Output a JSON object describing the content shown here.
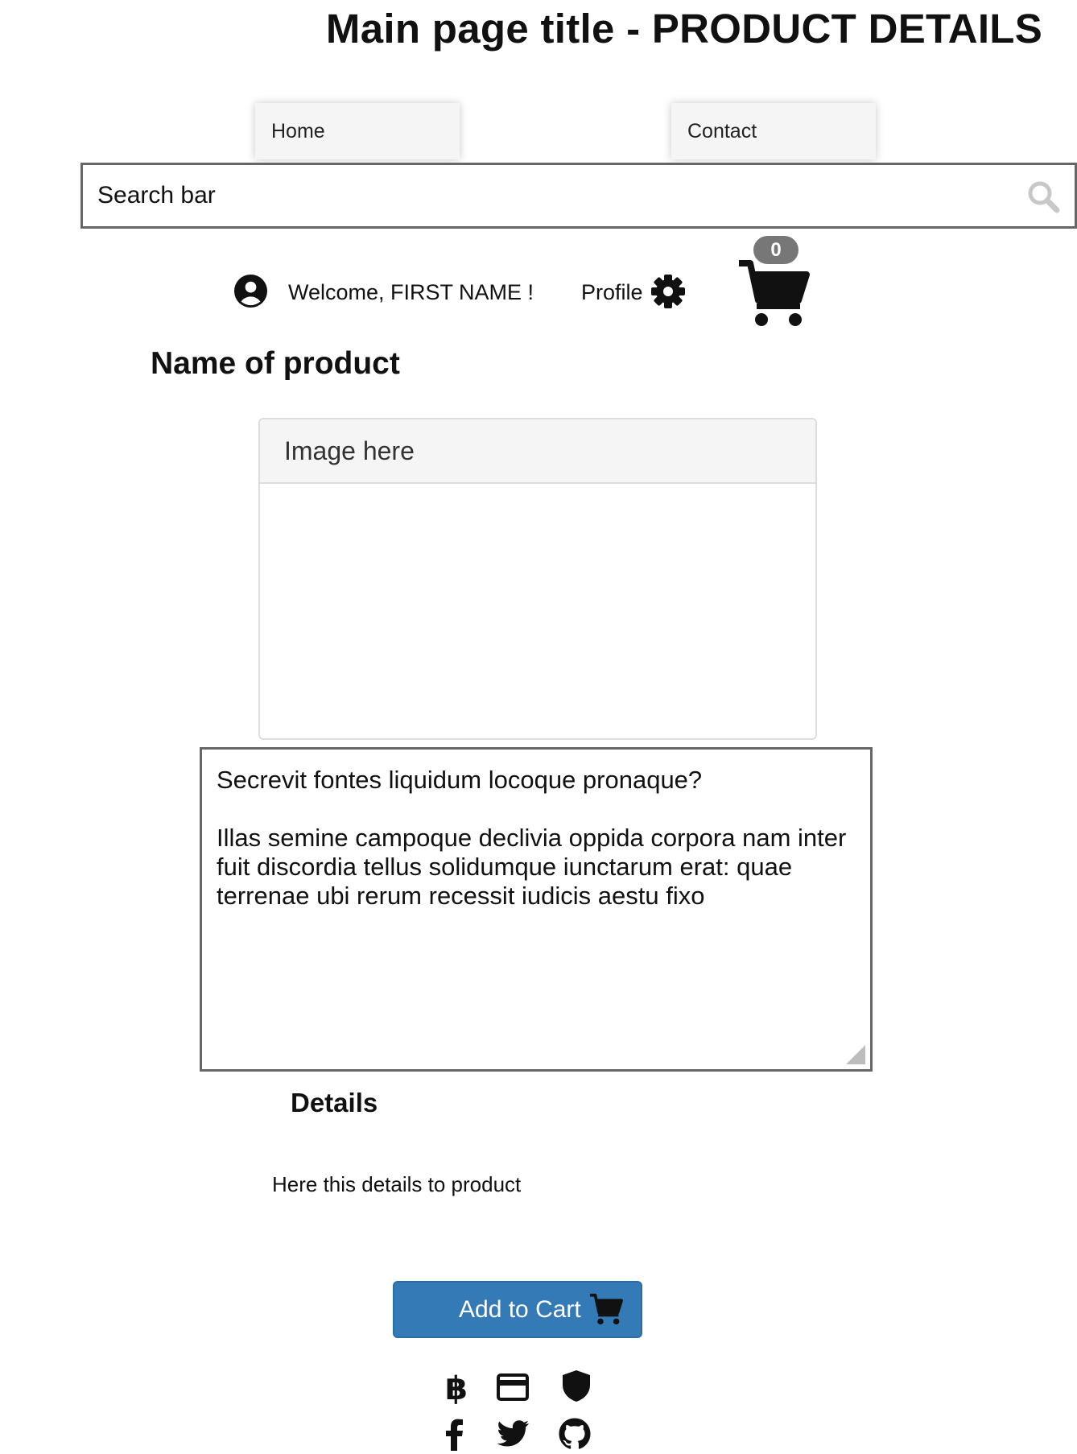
{
  "page": {
    "title": "Main page title - PRODUCT DETAILS"
  },
  "nav": {
    "home_label": "Home",
    "contact_label": "Contact"
  },
  "search": {
    "value": "Search bar",
    "icon": "search-icon"
  },
  "user_bar": {
    "welcome_text": "Welcome, FIRST NAME !",
    "profile_label": "Profile",
    "cart_count": "0"
  },
  "product": {
    "name": "Name of product",
    "image_panel_title": "Image here",
    "description_question": "Secrevit fontes liquidum locoque pronaque?",
    "description_body": "Illas semine campoque declivia oppida corpora nam inter fuit discordia tellus solidumque iunctarum erat: quae terrenae ubi rerum recessit iudicis aestu fixo",
    "details_heading": "Details",
    "details_text": "Here this details to product"
  },
  "actions": {
    "add_to_cart_label": "Add to Cart"
  },
  "footer": {
    "icons": [
      "bitcoin-icon",
      "credit-card-icon",
      "shield-icon",
      "facebook-icon",
      "twitter-icon",
      "github-icon"
    ]
  },
  "colors": {
    "primary_button": "#337ab7",
    "badge": "#777777",
    "border": "#666666"
  }
}
